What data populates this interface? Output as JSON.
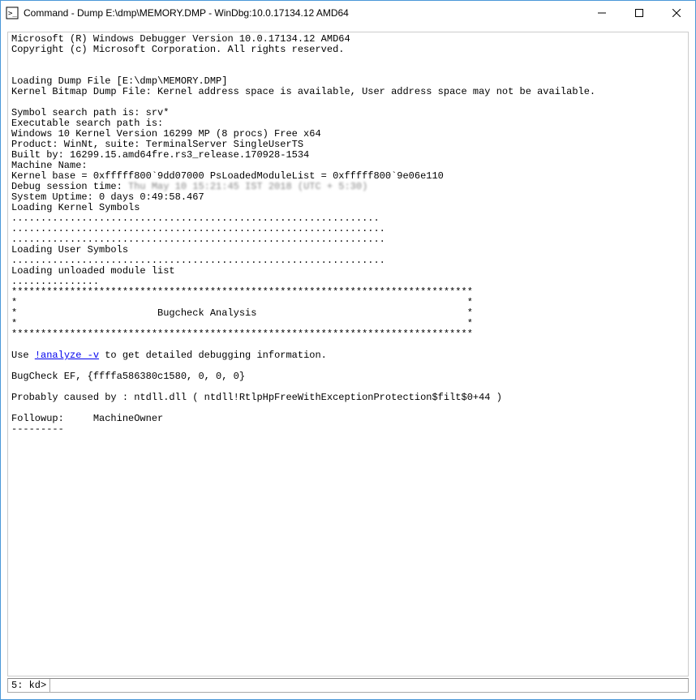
{
  "window": {
    "title": "Command - Dump E:\\dmp\\MEMORY.DMP - WinDbg:10.0.17134.12 AMD64"
  },
  "output": {
    "line1": "Microsoft (R) Windows Debugger Version 10.0.17134.12 AMD64",
    "line2": "Copyright (c) Microsoft Corporation. All rights reserved.",
    "blank1": "",
    "blank2": "",
    "line3": "Loading Dump File [E:\\dmp\\MEMORY.DMP]",
    "line4": "Kernel Bitmap Dump File: Kernel address space is available, User address space may not be available.",
    "blank3": "",
    "line5": "Symbol search path is: srv*",
    "line6": "Executable search path is: ",
    "line7": "Windows 10 Kernel Version 16299 MP (8 procs) Free x64",
    "line8": "Product: WinNt, suite: TerminalServer SingleUserTS",
    "line9": "Built by: 16299.15.amd64fre.rs3_release.170928-1534",
    "line10": "Machine Name:",
    "line11": "Kernel base = 0xfffff800`9dd07000 PsLoadedModuleList = 0xfffff800`9e06e110",
    "line12a": "Debug session time: ",
    "line12b": "Thu May 10 15:21:45 IST 2018 (UTC + 5:30)",
    "line13": "System Uptime: 0 days 0:49:58.467",
    "line14": "Loading Kernel Symbols",
    "dots1": "...............................................................",
    "dots2": "................................................................",
    "dots3": "................................................................",
    "line15": "Loading User Symbols",
    "dots4": "................................................................",
    "line16": "Loading unloaded module list",
    "dots5": "...............",
    "stars1": "*******************************************************************************",
    "stars2": "*                                                                             *",
    "stars3": "*                        Bugcheck Analysis                                    *",
    "stars4": "*                                                                             *",
    "stars5": "*******************************************************************************",
    "blank4": "",
    "use_pre": "Use ",
    "analyze_link": "!analyze -v",
    "use_post": " to get detailed debugging information.",
    "blank5": "",
    "bugcheck": "BugCheck EF, {ffffa586380c1580, 0, 0, 0}",
    "blank6": "",
    "caused": "Probably caused by : ntdll.dll ( ntdll!RtlpHpFreeWithExceptionProtection$filt$0+44 )",
    "blank7": "",
    "followup": "Followup:     MachineOwner",
    "dashes": "---------"
  },
  "prompt": {
    "label": "5: kd>",
    "value": ""
  }
}
